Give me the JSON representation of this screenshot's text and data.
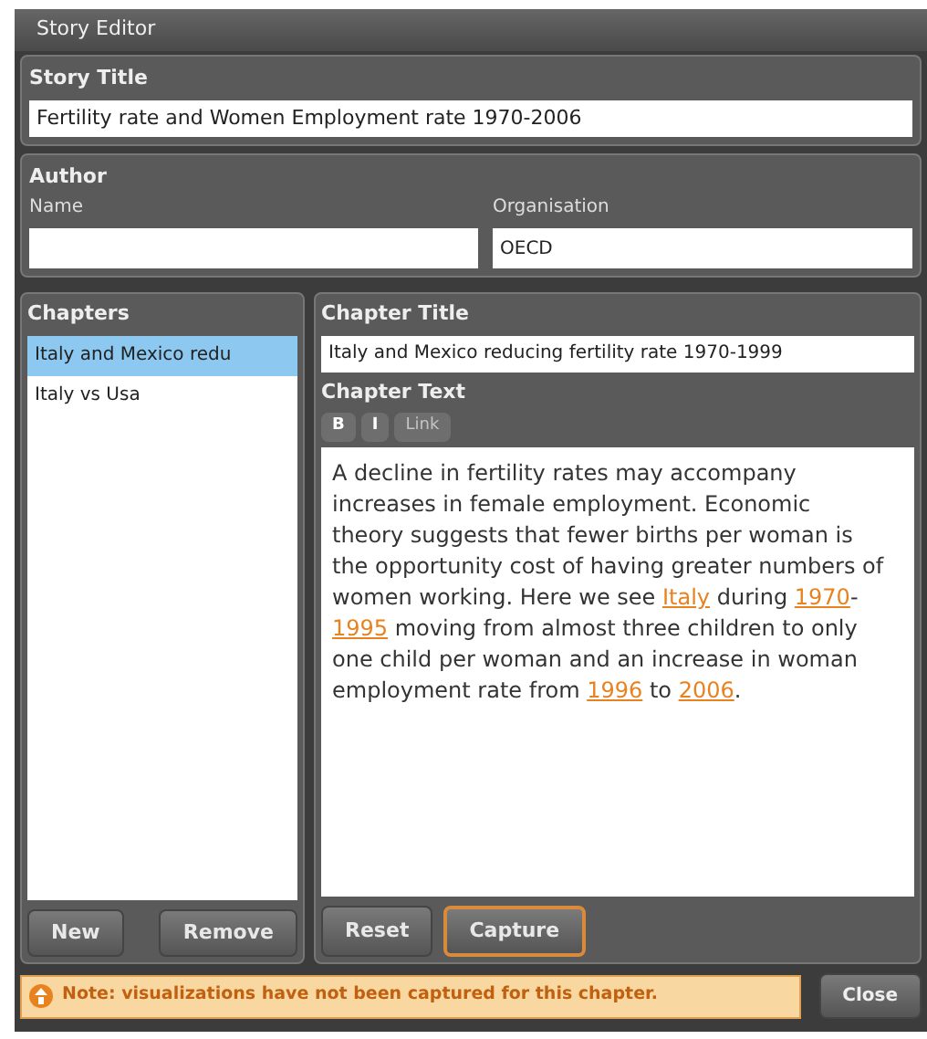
{
  "window": {
    "title": "Story Editor"
  },
  "story_title": {
    "label": "Story Title",
    "value": "Fertility rate and Women Employment rate 1970-2006"
  },
  "author": {
    "label": "Author",
    "name_label": "Name",
    "organisation_label": "Organisation",
    "organisation_value": "OECD"
  },
  "chapters": {
    "label": "Chapters",
    "items": [
      {
        "label": "Italy and Mexico redu",
        "selected": true
      },
      {
        "label": "Italy vs Usa",
        "selected": false
      }
    ],
    "buttons": [
      {
        "label": "New"
      },
      {
        "label": "Remove"
      }
    ]
  },
  "chapter": {
    "title_label": "Chapter Title",
    "title_value": "Italy and Mexico reducing fertility rate 1970-1999",
    "text_label": "Chapter Text",
    "format_buttons": [
      {
        "label": "B",
        "disabled": false
      },
      {
        "label": "I",
        "disabled": false
      },
      {
        "label": "Link",
        "disabled": true
      }
    ],
    "text": [
      {
        "kind": "text",
        "text": "A decline in fertility rates may accompany increases in female employment. Economic theory suggests that fewer births per woman is the opportunity cost of having greater numbers of women working. Here we see "
      },
      {
        "kind": "link",
        "text": "Italy"
      },
      {
        "kind": "text",
        "text": " during "
      },
      {
        "kind": "link",
        "text": "1970"
      },
      {
        "kind": "text",
        "text": "-"
      },
      {
        "kind": "link",
        "text": "1995"
      },
      {
        "kind": "text",
        "text": " moving from almost three children to only one child per woman and an increase in woman employment rate from "
      },
      {
        "kind": "link",
        "text": "1996"
      },
      {
        "kind": "text",
        "text": " to "
      },
      {
        "kind": "link",
        "text": "2006"
      },
      {
        "kind": "text",
        "text": "."
      }
    ],
    "buttons": [
      {
        "label": "Reset",
        "emphasized": false
      },
      {
        "label": "Capture",
        "emphasized": true
      }
    ]
  },
  "note": {
    "text": "Note: visualizations have not been captured for this chapter."
  },
  "close_button": {
    "label": "Close"
  }
}
